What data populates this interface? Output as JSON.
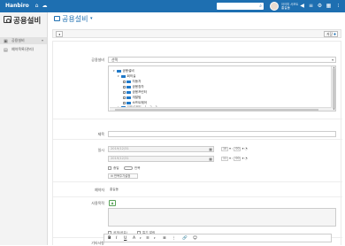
{
  "topbar": {
    "logo": "Hanbiro",
    "home_icon": "home-icon",
    "cloud_icon": "cloud-icon",
    "search_placeholder": "",
    "user_org": "아이피 서포트",
    "user_name": "홍길동",
    "icons": [
      "bell-icon",
      "menu-icon",
      "settings-icon",
      "grid-icon",
      "apps-icon"
    ],
    "bg": "#1e6fb1"
  },
  "sidebar": {
    "title": "공용설비",
    "items": [
      {
        "label": "공용설비",
        "icon": "calendar-icon",
        "active": true
      },
      {
        "label": "예약목록(관리)",
        "icon": "list-icon",
        "active": false
      }
    ]
  },
  "header": {
    "title": "공용설비",
    "caret": "▾"
  },
  "toolbar": {
    "back_label": "◂",
    "save_label": "저장"
  },
  "form": {
    "equipment": {
      "label": "공용설비",
      "select_value": "선택",
      "tree": [
        {
          "label": "공용설비",
          "level": 0
        },
        {
          "label": "회의실",
          "level": 1
        },
        {
          "label": "자동차",
          "level": 2
        },
        {
          "label": "공용창차",
          "level": 2
        },
        {
          "label": "공용프린터",
          "level": 2
        },
        {
          "label": "개발팀",
          "level": 2
        },
        {
          "label": "소프트웨어",
          "level": 2
        },
        {
          "label": "빔프로젝트 - 1 - 2 - 3",
          "level": 1
        }
      ]
    },
    "subject": {
      "label": "제목",
      "value": ""
    },
    "period": {
      "label": "일시",
      "start_date": "2019/12/31",
      "end_date": "2019/12/31",
      "start_hour": "10",
      "start_min": "00",
      "end_hour": "11",
      "end_min": "00",
      "allday_label": "종일",
      "repeat_toggle_label": "반복",
      "repeat_button_label": "반복주기설정"
    },
    "owner": {
      "label": "예약자",
      "value": "홍길동"
    },
    "purpose": {
      "label": "사용목적",
      "value": ""
    },
    "options": {
      "public_label": "공개(공유)",
      "attend_label": "특기 알림"
    },
    "notes": {
      "label": "기타사항"
    },
    "editor_tools": [
      "B",
      "I",
      "U",
      "A",
      "≡",
      "≣",
      "⋮",
      "🔗",
      "☺"
    ]
  }
}
